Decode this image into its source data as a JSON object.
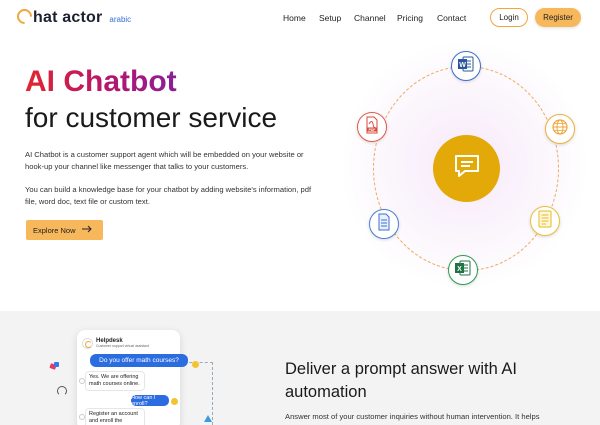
{
  "brand": {
    "logo_text": "hat actor",
    "logo_sub": "arabic",
    "accent": "#f0a63a"
  },
  "nav": {
    "links": [
      "Home",
      "Setup",
      "Channel",
      "Pricing",
      "Contact"
    ],
    "login": "Login",
    "register": "Register"
  },
  "hero": {
    "title_line1": "AI Chatbot",
    "title_line2": "for customer service",
    "paragraph1": "AI Chatbot is a customer support agent which will be embedded on your website or hook-up your channel like messenger that talks to your customers.",
    "paragraph2": "You can build a knowledge base for your chatbot by adding website's information, pdf file, word doc, text file or custom text.",
    "cta": "Explore Now"
  },
  "orbit": {
    "center_icon": "chat-bubble-icon",
    "nodes": [
      "word-doc-icon",
      "globe-icon",
      "text-file-icon",
      "excel-icon",
      "document-icon",
      "pdf-icon"
    ],
    "center_color": "#e2a908"
  },
  "section2": {
    "phone": {
      "title": "Helpdesk",
      "subtitle": "Customer support virtual assistant",
      "question1": "Do you offer math courses?",
      "answer1": "Yes. We are offering math courses online.",
      "question2": "How can I enroll?",
      "answer2": "Register an account and enroll the courses."
    },
    "title": "Deliver a prompt answer with AI automation",
    "paragraph": "Answer most of your customer inquiries without human intervention. It helps"
  }
}
